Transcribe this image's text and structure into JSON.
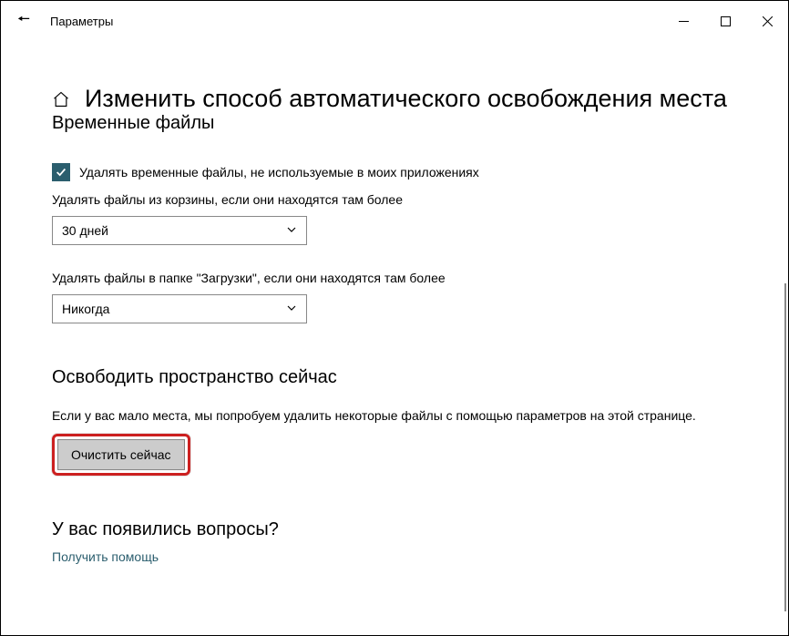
{
  "titlebar": {
    "title": "Параметры"
  },
  "header": {
    "heading": "Изменить способ автоматического освобождения места",
    "subheading": "Временные файлы"
  },
  "temp_files": {
    "checkbox_label": "Удалять временные файлы, не используемые в моих приложениях",
    "recycle_label": "Удалять файлы из корзины, если они находятся там более",
    "recycle_value": "30 дней",
    "downloads_label": "Удалять файлы в папке \"Загрузки\", если они находятся там более",
    "downloads_value": "Никогда"
  },
  "free_space": {
    "header": "Освободить пространство сейчас",
    "description": "Если у вас мало места, мы попробуем удалить некоторые файлы с помощью параметров на этой странице.",
    "button": "Очистить сейчас"
  },
  "questions": {
    "header": "У вас появились вопросы?",
    "link": "Получить помощь"
  }
}
